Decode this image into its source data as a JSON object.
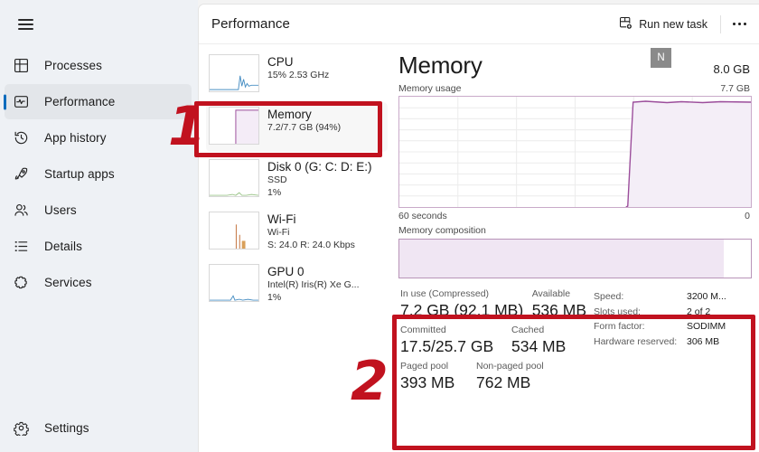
{
  "sidebar": {
    "menu_icon": "hamburger-icon",
    "items": [
      {
        "id": "processes",
        "label": "Processes",
        "icon": "processes-icon"
      },
      {
        "id": "performance",
        "label": "Performance",
        "icon": "performance-icon"
      },
      {
        "id": "app-history",
        "label": "App history",
        "icon": "history-icon"
      },
      {
        "id": "startup-apps",
        "label": "Startup apps",
        "icon": "rocket-icon"
      },
      {
        "id": "users",
        "label": "Users",
        "icon": "users-icon"
      },
      {
        "id": "details",
        "label": "Details",
        "icon": "list-icon"
      },
      {
        "id": "services",
        "label": "Services",
        "icon": "services-icon"
      }
    ],
    "active": "performance",
    "settings": {
      "id": "settings",
      "label": "Settings",
      "icon": "gear-icon"
    }
  },
  "header": {
    "title": "Performance",
    "run_new_task": "Run new task",
    "run_new_task_icon": "new-task-icon",
    "more_label": "more-options-icon"
  },
  "device_list": [
    {
      "id": "cpu",
      "name": "CPU",
      "lines": [
        "15% 2.53 GHz"
      ],
      "selected": false
    },
    {
      "id": "memory",
      "name": "Memory",
      "lines": [
        "7.2/7.7 GB (94%)"
      ],
      "selected": true
    },
    {
      "id": "disk0",
      "name": "Disk 0 (G: C: D: E:)",
      "lines": [
        "SSD",
        "1%"
      ],
      "selected": false
    },
    {
      "id": "wifi",
      "name": "Wi-Fi",
      "lines": [
        "Wi-Fi",
        "S: 24.0 R: 24.0 Kbps"
      ],
      "selected": false
    },
    {
      "id": "gpu0",
      "name": "GPU 0",
      "lines": [
        "Intel(R) Iris(R) Xe G...",
        "1%"
      ],
      "selected": false
    }
  ],
  "detail": {
    "title": "Memory",
    "capacity": "8.0 GB",
    "graph_label": "Memory usage",
    "graph_max": "7.7 GB",
    "axis_left": "60 seconds",
    "axis_right": "0",
    "composition_label": "Memory composition",
    "badge": "N",
    "stats": [
      {
        "label": "In use (Compressed)",
        "value": "7.2 GB (92.1 MB)"
      },
      {
        "label": "Available",
        "value": "536 MB"
      },
      {
        "label": "Committed",
        "value": "17.5/25.7 GB"
      },
      {
        "label": "Cached",
        "value": "534 MB"
      },
      {
        "label": "Paged pool",
        "value": "393 MB"
      },
      {
        "label": "Non-paged pool",
        "value": "762 MB"
      }
    ],
    "specs": [
      {
        "key": "Speed:",
        "value": "3200 M..."
      },
      {
        "key": "Slots used:",
        "value": "2 of 2"
      },
      {
        "key": "Form factor:",
        "value": "SODIMM"
      },
      {
        "key": "Hardware reserved:",
        "value": "306 MB"
      }
    ]
  },
  "annotations": [
    {
      "id": "1",
      "number": "1"
    },
    {
      "id": "2",
      "number": "2"
    }
  ],
  "colors": {
    "accent_purple": "#9B4D9B",
    "graph_fill": "#f0e6f3",
    "annotation_red": "#c1121f",
    "selection_blue": "#0f6cbd"
  },
  "chart_data": {
    "type": "area",
    "title": "Memory usage",
    "xlabel": "",
    "ylabel": "",
    "xlim": [
      0,
      60
    ],
    "ylim": [
      0,
      7.7
    ],
    "x_tick_labels": [
      "60 seconds",
      "0"
    ],
    "y_max_label": "7.7 GB",
    "grid": true,
    "series": [
      {
        "name": "Memory usage",
        "color": "#9B4D9B",
        "x": [
          0,
          38,
          39,
          40,
          41,
          45,
          48,
          52,
          55,
          58,
          60
        ],
        "values": [
          0,
          0,
          0.1,
          7.15,
          7.2,
          7.2,
          7.16,
          7.2,
          7.17,
          7.2,
          7.2
        ]
      }
    ],
    "composition_bar": {
      "type": "bar",
      "label": "Memory composition",
      "segments": [
        {
          "name": "In use",
          "percent": 92.4,
          "color": "#f0e6f3"
        },
        {
          "name": "Free",
          "percent": 7.6,
          "color": "#ffffff"
        }
      ]
    }
  }
}
